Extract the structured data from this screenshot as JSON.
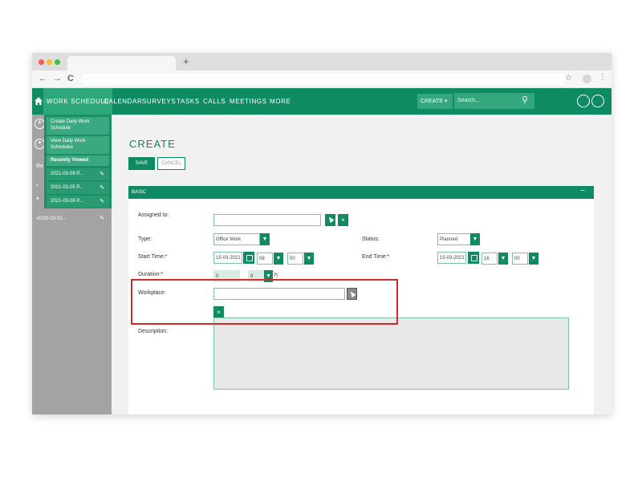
{
  "browser": {
    "new_tab": "+",
    "nav_back": "←",
    "nav_forward": "→",
    "nav_reload": "C",
    "star": "☆",
    "kebab": "⋮"
  },
  "appnav": {
    "items": [
      "WORK SCHEDULE",
      "CALENDAR",
      "SURVEYS",
      "TASKS",
      "CALLS",
      "MEETINGS",
      "MORE"
    ],
    "create_label": "CREATE",
    "search_placeholder": "Search..."
  },
  "dropdown": {
    "create_daily": "Create Daily Work Schedule",
    "view_daily": "View Daily Work Schedules",
    "recently_viewed": "Recently Viewed",
    "recent": [
      "2021-03-09 P...",
      "2021-03-05 P...",
      "2021-03-08 P..."
    ]
  },
  "sidebar": {
    "partial_label": "Re",
    "recent_item": "2020-03-01 -"
  },
  "form": {
    "title": "CREATE",
    "save": "SAVE",
    "cancel": "CANCEL",
    "panel_title": "BASIC",
    "collapse": "−",
    "assigned_to_label": "Assigned to:",
    "type_label": "Type:",
    "type_value": "Office Work",
    "status_label": "Status:",
    "status_value": "Planned",
    "start_time_label": "Start Time:*",
    "start_date": "15-03-2021",
    "start_hour": "08",
    "start_min": "00",
    "end_time_label": "End Time:*",
    "end_date": "15-03-2021",
    "end_hour": "16",
    "end_min": "00",
    "duration_label": "Duration:*",
    "duration_days": "0",
    "duration_hours": "8",
    "duration_suffix": "h",
    "workplace_label": "Workplace:",
    "description_label": "Description:"
  },
  "colors": {
    "primary": "#0e8b62",
    "active_nav": "#2ea77a",
    "sidebar": "#a3a3a3",
    "highlight": "#d62a2a"
  }
}
